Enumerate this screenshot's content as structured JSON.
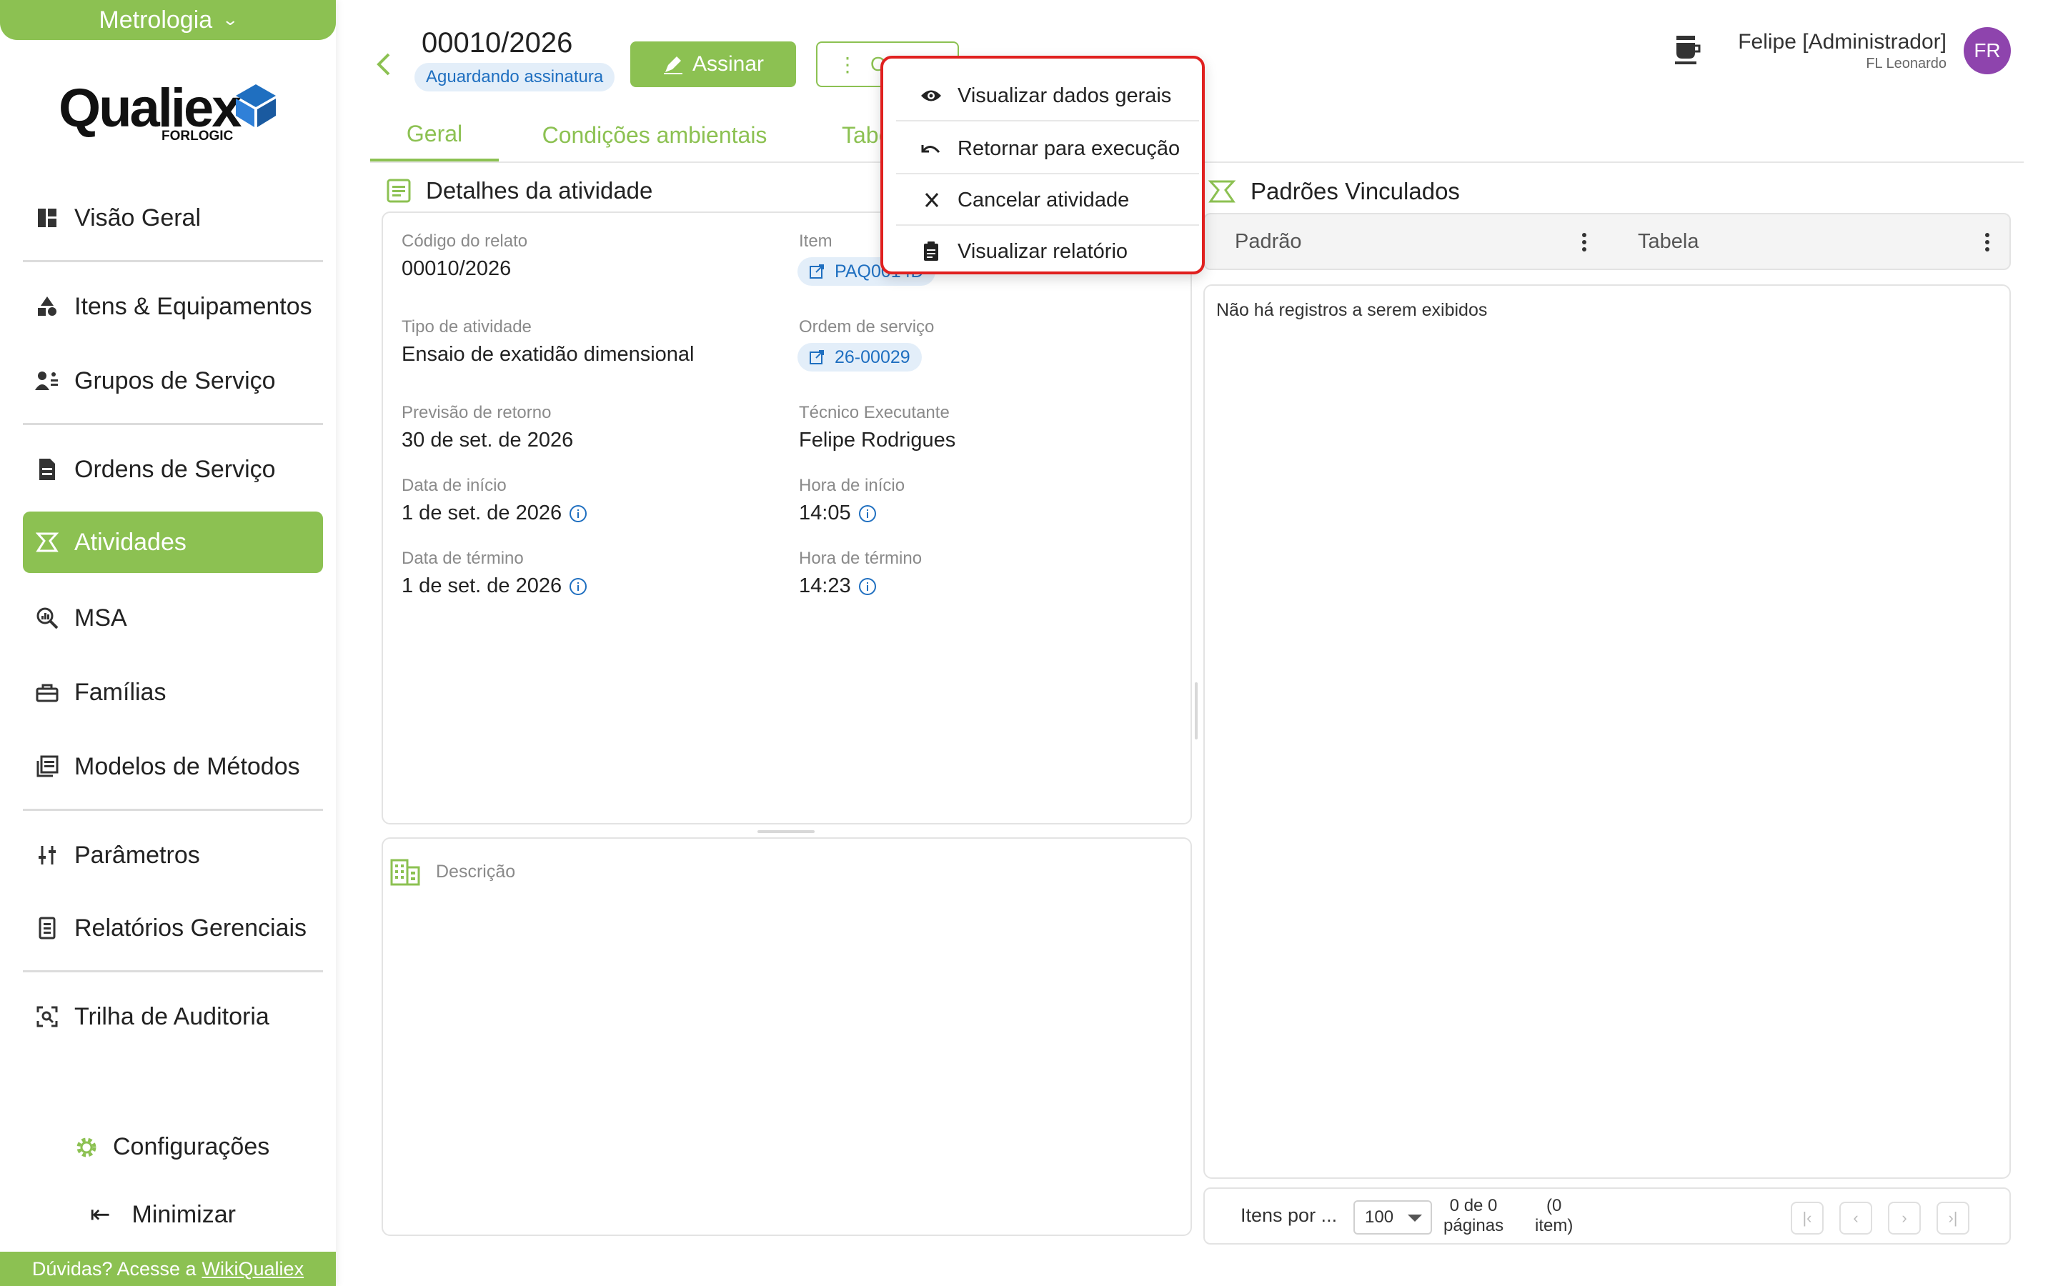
{
  "sidebar": {
    "module": "Metrologia",
    "logo": {
      "name": "Qualiex",
      "sub": "FORLOGIC"
    },
    "items": [
      {
        "label": "Visão Geral",
        "icon": "dashboard-icon"
      },
      {
        "label": "Itens & Equipamentos",
        "icon": "shapes-icon"
      },
      {
        "label": "Grupos de Serviço",
        "icon": "group-icon"
      },
      {
        "label": "Ordens de Serviço",
        "icon": "document-icon"
      },
      {
        "label": "Atividades",
        "icon": "activity-icon",
        "active": true
      },
      {
        "label": "MSA",
        "icon": "analytics-icon"
      },
      {
        "label": "Famílias",
        "icon": "toolbox-icon"
      },
      {
        "label": "Modelos de Métodos",
        "icon": "library-icon"
      },
      {
        "label": "Parâmetros",
        "icon": "sliders-icon"
      },
      {
        "label": "Relatórios Gerenciais",
        "icon": "report-icon"
      },
      {
        "label": "Trilha de Auditoria",
        "icon": "audit-icon"
      }
    ],
    "settings": "Configurações",
    "minimize": "Minimizar",
    "help": {
      "text": "Dúvidas? Acesse a",
      "link": "WikiQualiex"
    }
  },
  "header": {
    "title": "00010/2026",
    "status": "Aguardando assinatura",
    "sign_label": "Assinar",
    "options_label": "Opções",
    "user_name": "Felipe [Administrador]",
    "user_sub": "FL Leonardo",
    "avatar": "FR"
  },
  "tabs": [
    "Geral",
    "Condições ambientais",
    "Tabelas"
  ],
  "details": {
    "title": "Detalhes da atividade",
    "fields": {
      "codigo_label": "Código do relato",
      "codigo_value": "00010/2026",
      "item_label": "Item",
      "item_value": "PAQ0014D",
      "tipo_label": "Tipo de atividade",
      "tipo_value": "Ensaio de exatidão dimensional",
      "ordem_label": "Ordem de serviço",
      "ordem_value": "26-00029",
      "previsao_label": "Previsão de retorno",
      "previsao_value": "30 de set. de 2026",
      "tecnico_label": "Técnico Executante",
      "tecnico_value": "Felipe Rodrigues",
      "data_inicio_label": "Data de início",
      "data_inicio_value": "1 de set. de 2026",
      "hora_inicio_label": "Hora de início",
      "hora_inicio_value": "14:05",
      "data_termino_label": "Data de término",
      "data_termino_value": "1 de set. de 2026",
      "hora_termino_label": "Hora de término",
      "hora_termino_value": "14:23"
    },
    "description_label": "Descrição"
  },
  "standards": {
    "title": "Padrões Vinculados",
    "columns": [
      "Padrão",
      "Tabela"
    ],
    "empty": "Não há registros a serem exibidos",
    "pager": {
      "items_per_page": "Itens por ...",
      "size": "100",
      "pages": "0 de 0",
      "pages2": "páginas",
      "items": "(0",
      "items2": "item)"
    }
  },
  "menu": {
    "items": [
      {
        "label": "Visualizar dados gerais",
        "icon": "eye-icon"
      },
      {
        "label": "Retornar para execução",
        "icon": "undo-icon"
      },
      {
        "label": "Cancelar atividade",
        "icon": "close-icon"
      },
      {
        "label": "Visualizar relatório",
        "icon": "clipboard-icon"
      }
    ]
  },
  "colors": {
    "accent": "#8cc152",
    "link": "#1f6fc0",
    "highlight": "#e0201f",
    "avatar": "#8e44ad"
  }
}
